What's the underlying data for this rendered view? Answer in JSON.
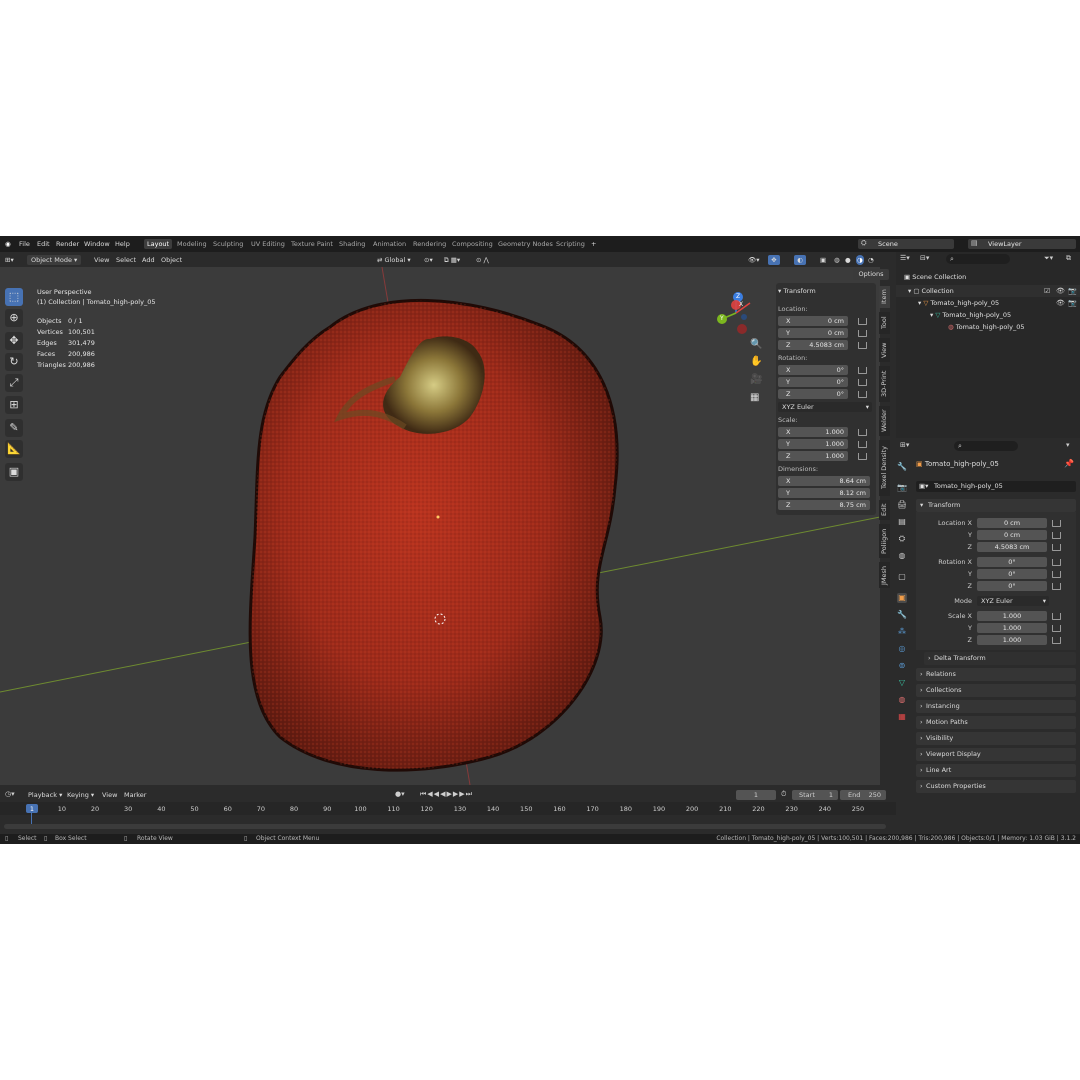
{
  "menus": [
    "File",
    "Edit",
    "Render",
    "Window",
    "Help"
  ],
  "workspaces": [
    "Layout",
    "Modeling",
    "Sculpting",
    "UV Editing",
    "Texture Paint",
    "Shading",
    "Animation",
    "Rendering",
    "Compositing",
    "Geometry Nodes",
    "Scripting"
  ],
  "active_workspace": "Layout",
  "add_workspace": "+",
  "scene": {
    "label": "Scene",
    "viewlayer": "ViewLayer"
  },
  "viewport_header": {
    "mode": "Object Mode",
    "menus": [
      "View",
      "Select",
      "Add",
      "Object"
    ],
    "transform_orientation": "Global",
    "options": "Options"
  },
  "overlay_info": {
    "perspective": "User Perspective",
    "collection": "(1) Collection | Tomato_high-poly_05",
    "stats": [
      {
        "label": "Objects",
        "value": "0 / 1"
      },
      {
        "label": "Vertices",
        "value": "100,501"
      },
      {
        "label": "Edges",
        "value": "301,479"
      },
      {
        "label": "Faces",
        "value": "200,986"
      },
      {
        "label": "Triangles",
        "value": "200,986"
      }
    ]
  },
  "gizmo": {
    "x": "X",
    "y": "Y",
    "z": "Z"
  },
  "n_panel": {
    "title": "Transform",
    "location_label": "Location:",
    "location": [
      {
        "axis": "X",
        "value": "0 cm"
      },
      {
        "axis": "Y",
        "value": "0 cm"
      },
      {
        "axis": "Z",
        "value": "4.5083 cm"
      }
    ],
    "rotation_label": "Rotation:",
    "rotation": [
      {
        "axis": "X",
        "value": "0°"
      },
      {
        "axis": "Y",
        "value": "0°"
      },
      {
        "axis": "Z",
        "value": "0°"
      }
    ],
    "rotation_mode": "XYZ Euler",
    "scale_label": "Scale:",
    "scale": [
      {
        "axis": "X",
        "value": "1.000"
      },
      {
        "axis": "Y",
        "value": "1.000"
      },
      {
        "axis": "Z",
        "value": "1.000"
      }
    ],
    "dimensions_label": "Dimensions:",
    "dimensions": [
      {
        "axis": "X",
        "value": "8.64 cm"
      },
      {
        "axis": "Y",
        "value": "8.12 cm"
      },
      {
        "axis": "Z",
        "value": "8.75 cm"
      }
    ]
  },
  "side_tabs": [
    "Item",
    "Tool",
    "View",
    "3D-Print",
    "Welder",
    "Texel Density",
    "Edit",
    "Poliigon",
    "JMesh"
  ],
  "outliner": {
    "scene_collection": "Scene Collection",
    "collection": "Collection",
    "object": "Tomato_high-poly_05",
    "mesh": "Tomato_high-poly_05",
    "material": "Tomato_high-poly_05"
  },
  "properties": {
    "object_name": "Tomato_high-poly_05",
    "object_field": "Tomato_high-poly_05",
    "transform_title": "Transform",
    "location": [
      {
        "label": "Location X",
        "value": "0 cm"
      },
      {
        "label": "Y",
        "value": "0 cm"
      },
      {
        "label": "Z",
        "value": "4.5083 cm"
      }
    ],
    "rotation": [
      {
        "label": "Rotation X",
        "value": "0°"
      },
      {
        "label": "Y",
        "value": "0°"
      },
      {
        "label": "Z",
        "value": "0°"
      }
    ],
    "mode_label": "Mode",
    "mode_value": "XYZ Euler",
    "scale": [
      {
        "label": "Scale X",
        "value": "1.000"
      },
      {
        "label": "Y",
        "value": "1.000"
      },
      {
        "label": "Z",
        "value": "1.000"
      }
    ],
    "delta": "Delta Transform",
    "sections": [
      "Relations",
      "Collections",
      "Instancing",
      "Motion Paths",
      "Visibility",
      "Viewport Display",
      "Line Art",
      "Custom Properties"
    ]
  },
  "timeline": {
    "menus": [
      "Playback",
      "Keying",
      "View",
      "Marker"
    ],
    "current_frame": "1",
    "start_label": "Start",
    "start": "1",
    "end_label": "End",
    "end": "250",
    "ticks": [
      "1",
      "10",
      "20",
      "30",
      "40",
      "50",
      "60",
      "70",
      "80",
      "90",
      "100",
      "110",
      "120",
      "130",
      "140",
      "150",
      "160",
      "170",
      "180",
      "190",
      "200",
      "210",
      "220",
      "230",
      "240",
      "250"
    ]
  },
  "statusbar": {
    "select": "Select",
    "box_select": "Box Select",
    "rotate": "Rotate View",
    "context": "Object Context Menu",
    "info": "Collection | Tomato_high-poly_05 | Verts:100,501 | Faces:200,986 | Tris:200,986 | Objects:0/1 | Memory: 1.03 GiB | 3.1.2"
  },
  "colors": {
    "accent": "#4772b3",
    "x_axis": "#e2423f",
    "y_axis": "#7cb71f",
    "z_axis": "#3b7ee1",
    "tomato": "#a8301e"
  }
}
